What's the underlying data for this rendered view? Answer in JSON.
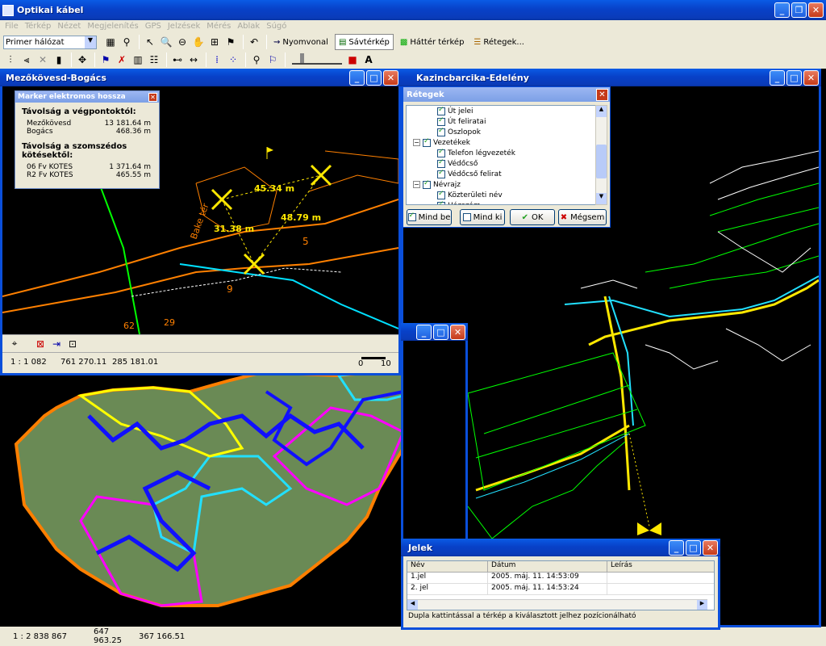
{
  "app": {
    "title": "Optikai kábel"
  },
  "menu": [
    "File",
    "Térkép",
    "Nézet",
    "Megjelenítés",
    "GPS",
    "Jelzések",
    "Mérés",
    "Ablak",
    "Súgó"
  ],
  "toolbar": {
    "layer_select": "Primer hálózat",
    "nyomvonal": "Nyomvonal",
    "savterkep": "Sávtérkép",
    "hatter": "Háttér térkép",
    "retegek": "Rétegek..."
  },
  "win1": {
    "title": "Mezőkövesd-Bogács",
    "scale": "1 : 1 082",
    "x": "761 270.11",
    "y": "285 181.01",
    "scale_min": "0",
    "scale_max": "10",
    "labels": {
      "d1": "45.34 m",
      "d2": "31.38 m",
      "d3": "48.79 m",
      "street": "Bake tér",
      "n1": "9",
      "n2": "5",
      "n3": "62",
      "n4": "29"
    }
  },
  "marker": {
    "title": "Marker elektromos hossza",
    "h1": "Távolság a végpontoktól:",
    "rows1": [
      {
        "name": "Mezőkövesd",
        "val": "13 181.64 m"
      },
      {
        "name": "Bogács",
        "val": "468.36 m"
      }
    ],
    "h2": "Távolság a szomszédos kötésektől:",
    "rows2": [
      {
        "name": "06 Fv KOTES",
        "val": "1 371.64 m"
      },
      {
        "name": "R2 Fv KOTES",
        "val": "465.55 m"
      }
    ]
  },
  "win2": {
    "title": "Kazincbarcika-Edelény"
  },
  "layers": {
    "title": "Rétegek",
    "items": [
      {
        "label": "Út jelei",
        "indent": 2,
        "checked": true
      },
      {
        "label": "Út feliratai",
        "indent": 2,
        "checked": true
      },
      {
        "label": "Oszlopok",
        "indent": 2,
        "checked": true
      },
      {
        "label": "Vezetékek",
        "indent": 1,
        "checked": true,
        "expand": "−"
      },
      {
        "label": "Telefon légvezeték",
        "indent": 2,
        "checked": true
      },
      {
        "label": "Védőcső",
        "indent": 2,
        "checked": true
      },
      {
        "label": "Védőcső felirat",
        "indent": 2,
        "checked": true
      },
      {
        "label": "Névrajz",
        "indent": 1,
        "checked": true,
        "expand": "−"
      },
      {
        "label": "Közterületi név",
        "indent": 2,
        "checked": true
      },
      {
        "label": "Házszám",
        "indent": 2,
        "checked": true
      }
    ],
    "all_on": "Mind be",
    "all_off": "Mind ki",
    "ok": "OK",
    "cancel": "Mégsem"
  },
  "jelek": {
    "title": "Jelek",
    "columns": [
      "Név",
      "Dátum",
      "Leírás"
    ],
    "rows": [
      [
        "1.jel",
        "2005. máj. 11. 14:53:09",
        ""
      ],
      [
        "2. jel",
        "2005. máj. 11. 14:53:24",
        ""
      ]
    ],
    "hint": "Dupla kattintással a térkép a kiválasztott jelhez pozícionálható"
  },
  "main_status": {
    "scale": "1 : 2 838 867",
    "x": "647 963.25",
    "y": "367 166.51"
  },
  "colors": {
    "accent": "#0a4fdb",
    "map_bg": "#000000",
    "marker": "#ffe800"
  }
}
